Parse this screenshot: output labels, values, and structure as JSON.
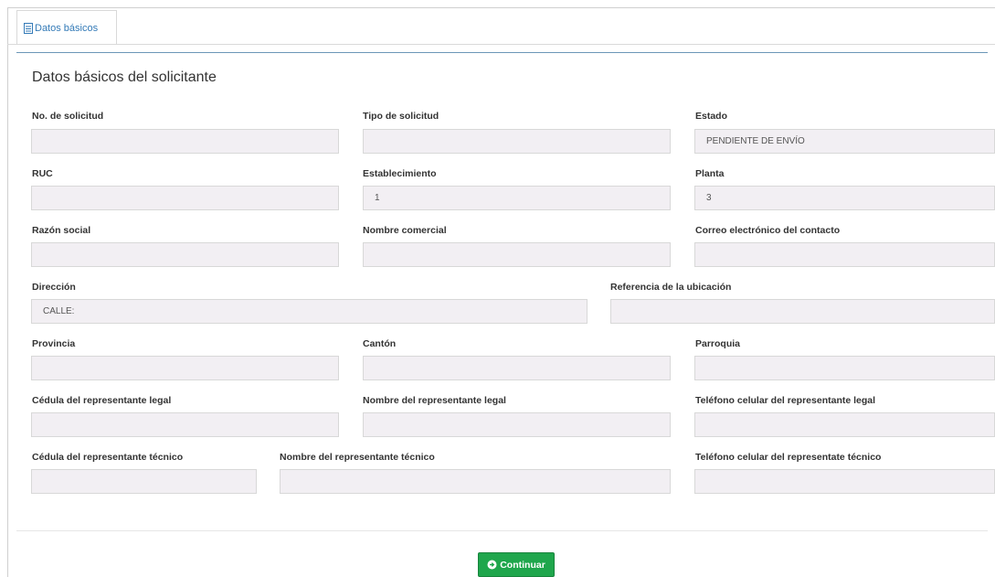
{
  "tab": {
    "label": "Datos básicos",
    "icon": "document-icon"
  },
  "section": {
    "title": "Datos básicos del solicitante"
  },
  "fields": {
    "no_solicitud": {
      "label": "No. de solicitud",
      "value": ""
    },
    "tipo_solicitud": {
      "label": "Tipo de solicitud",
      "value": ""
    },
    "estado": {
      "label": "Estado",
      "value": "PENDIENTE DE ENVÍO"
    },
    "ruc": {
      "label": "RUC",
      "value": ""
    },
    "establecimiento": {
      "label": "Establecimiento",
      "value": "1"
    },
    "planta": {
      "label": "Planta",
      "value": "3"
    },
    "razon_social": {
      "label": "Razón social",
      "value": ""
    },
    "nombre_comercial": {
      "label": "Nombre comercial",
      "value": ""
    },
    "correo_contacto": {
      "label": "Correo electrónico del contacto",
      "value": ""
    },
    "direccion": {
      "label": "Dirección",
      "value": "CALLE:"
    },
    "referencia_ubicacion": {
      "label": "Referencia de la ubicación",
      "value": ""
    },
    "provincia": {
      "label": "Provincia",
      "value": ""
    },
    "canton": {
      "label": "Cantón",
      "value": ""
    },
    "parroquia": {
      "label": "Parroquia",
      "value": ""
    },
    "cedula_rep_legal": {
      "label": "Cédula del representante legal",
      "value": ""
    },
    "nombre_rep_legal": {
      "label": "Nombre del representante legal",
      "value": ""
    },
    "telefono_rep_legal": {
      "label": "Teléfono celular del representante legal",
      "value": ""
    },
    "cedula_rep_tecnico": {
      "label": "Cédula del representante técnico",
      "value": ""
    },
    "nombre_rep_tecnico": {
      "label": "Nombre del representante técnico",
      "value": ""
    },
    "telefono_rep_tecnico": {
      "label": "Teléfono celular del representate técnico",
      "value": ""
    }
  },
  "actions": {
    "continuar_label": "Continuar",
    "continuar_icon": "arrow-circle-right-icon"
  },
  "colors": {
    "accent": "#337ab7",
    "button": "#1fa64c",
    "field_bg": "#f2eff3",
    "panel_border": "#6c97b8"
  }
}
